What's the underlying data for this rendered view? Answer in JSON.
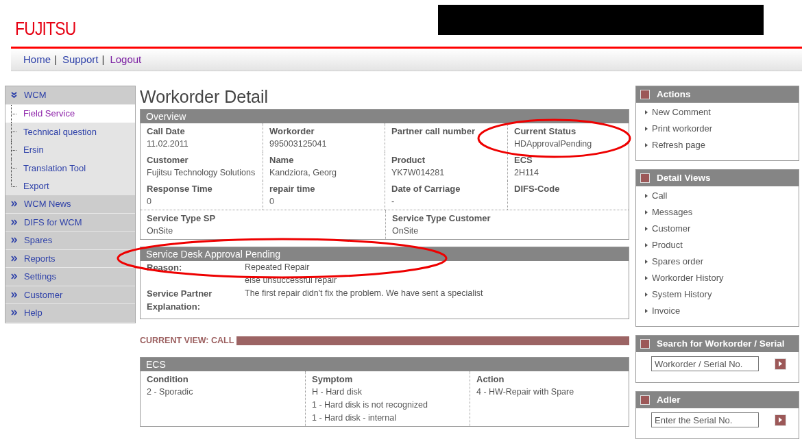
{
  "header": {
    "logo": "FUJITSU",
    "separator": "|",
    "nav": [
      {
        "label": "Home",
        "visited": false
      },
      {
        "label": "Support",
        "visited": false
      },
      {
        "label": "Logout",
        "visited": true
      }
    ]
  },
  "sidebar": {
    "items": [
      {
        "label": "WCM",
        "expanded": true,
        "children": [
          {
            "label": "Field Service",
            "selected": true
          },
          {
            "label": "Technical question",
            "selected": false
          },
          {
            "label": "Ersin",
            "selected": false
          },
          {
            "label": "Translation Tool",
            "selected": false
          },
          {
            "label": "Export",
            "selected": false
          }
        ]
      },
      {
        "label": "WCM News",
        "expanded": false
      },
      {
        "label": "DIFS for WCM",
        "expanded": false
      },
      {
        "label": "Spares",
        "expanded": false
      },
      {
        "label": "Reports",
        "expanded": false
      },
      {
        "label": "Settings",
        "expanded": false
      },
      {
        "label": "Customer",
        "expanded": false
      },
      {
        "label": "Help",
        "expanded": false
      }
    ]
  },
  "page_title": "Workorder Detail",
  "overview": {
    "title": "Overview",
    "fields": [
      {
        "label": "Call Date",
        "value": "11.02.2011"
      },
      {
        "label": "Workorder",
        "value": "995003125041"
      },
      {
        "label": "Partner call number"
      },
      {
        "label": "Current Status",
        "value": "HDApprovalPending",
        "highlighted": true
      },
      {
        "label": "Customer",
        "value": "Fujitsu Technology Solutions"
      },
      {
        "label": "Name",
        "value": "Kandziora, Georg"
      },
      {
        "label": "Product",
        "value": "YK7W014281"
      },
      {
        "label": "ECS",
        "value": "2H114"
      },
      {
        "label": "Response Time",
        "value": "0"
      },
      {
        "label": "repair time",
        "value": "0"
      },
      {
        "label": "Date of Carriage",
        "value": "-"
      },
      {
        "label": "DIFS-Code"
      }
    ],
    "service_fields": [
      {
        "label": "Service Type SP",
        "value": "OnSite"
      },
      {
        "label": "Service Type Customer",
        "value": "OnSite"
      }
    ]
  },
  "approval": {
    "title": "Service Desk Approval Pending",
    "highlighted": true,
    "rows": [
      {
        "label": "Reason:",
        "lines": [
          "Repeated Repair",
          "else unsuccessful repair"
        ]
      },
      {
        "label": "Service Partner Explanation:",
        "lines": [
          "The first repair didn't fix the problem. We have sent a specialist"
        ]
      }
    ]
  },
  "current_view": "CURRENT VIEW: CALL",
  "ecs": {
    "title": "ECS",
    "columns": [
      {
        "label": "Condition",
        "lines": [
          "2 - Sporadic"
        ]
      },
      {
        "label": "Symptom",
        "lines": [
          "H - Hard disk",
          "1 - Hard disk is not recognized",
          "1 - Hard disk - internal"
        ]
      },
      {
        "label": "Action",
        "lines": [
          "4 - HW-Repair with Spare"
        ]
      }
    ]
  },
  "right_panels": [
    {
      "kind": "links",
      "title": "Actions",
      "links": [
        "New Comment",
        "Print workorder",
        "Refresh page"
      ]
    },
    {
      "kind": "links",
      "title": "Detail Views",
      "links": [
        "Call",
        "Messages",
        "Customer",
        "Product",
        "Spares order",
        "Workorder History",
        "System History",
        "Invoice"
      ]
    },
    {
      "kind": "search",
      "title": "Search for Workorder / Serial",
      "placeholder": "Workorder / Serial No."
    },
    {
      "kind": "search",
      "title": "Adler",
      "placeholder": "Enter the Serial No."
    }
  ]
}
